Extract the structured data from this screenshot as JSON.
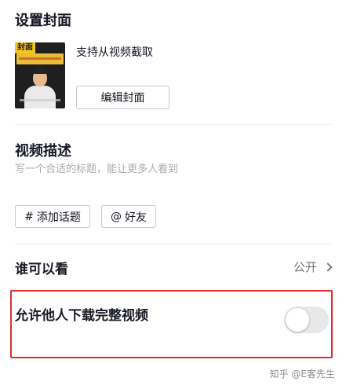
{
  "cover": {
    "title": "设置封面",
    "thumbnail_tag": "封面",
    "support_text": "支持从视频截取",
    "edit_button_label": "编辑封面"
  },
  "description": {
    "title": "视频描述",
    "placeholder": "写一个合适的标题，能让更多人看到"
  },
  "tags": {
    "topic_symbol": "#",
    "topic_label": "添加话题",
    "friend_symbol": "@",
    "friend_label": "好友"
  },
  "visibility": {
    "label": "谁可以看",
    "value": "公开"
  },
  "download": {
    "label": "允许他人下载完整视频",
    "enabled": false
  },
  "watermark": "知乎 @E客先生",
  "colors": {
    "highlight_border": "#e22c2c",
    "toggle_off_track": "#e7e8ea",
    "cover_tag": "#f5c518"
  }
}
